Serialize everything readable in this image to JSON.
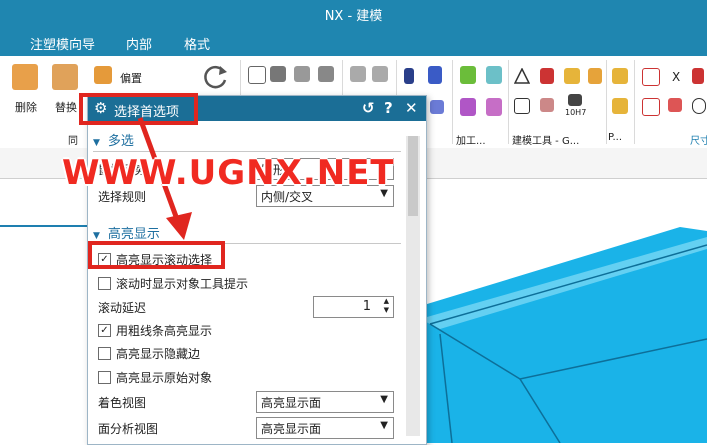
{
  "window": {
    "title": "NX - 建模"
  },
  "menu": {
    "items": [
      "注塑模向导",
      "内部",
      "格式"
    ]
  },
  "ribbon": {
    "delete_label": "删除",
    "replace_label": "替换",
    "offset_label": "偏置",
    "group_label_left": "同",
    "group_label_machining": "加工...",
    "group_label_modeling_tools": "建模工具 - G...",
    "group_label_p": "P...",
    "group_label_dim": "尺寸",
    "tool_text_x": "X",
    "tool_text_10h7": "10H7"
  },
  "dialog": {
    "title": "选择首选项",
    "reset_icon": "↺",
    "help_icon": "?",
    "close_icon": "✕",
    "section_multi": "多选",
    "gesture_label": "鼠标手势",
    "gesture_value": "矩形",
    "rule_label": "选择规则",
    "rule_value": "内侧/交叉",
    "section_highlight": "高亮显示",
    "cb_highlight_scroll": {
      "label": "高亮显示滚动选择",
      "checked": true
    },
    "cb_scroll_tooltip": {
      "label": "滚动时显示对象工具提示",
      "checked": false
    },
    "scroll_delay_label": "滚动延迟",
    "scroll_delay_value": "1",
    "cb_thick_lines": {
      "label": "用粗线条高亮显示",
      "checked": true
    },
    "cb_hidden_edges": {
      "label": "高亮显示隐藏边",
      "checked": false
    },
    "cb_original": {
      "label": "高亮显示原始对象",
      "checked": false
    },
    "shaded_view_label": "着色视图",
    "shaded_view_value": "高亮显示面",
    "face_analysis_label": "面分析视图",
    "face_analysis_value": "高亮显示面"
  },
  "watermark": "WWW.UGNX.NET",
  "colors": {
    "accent": "#1f86b0",
    "annotation": "#e0261f",
    "model": "#1ab3e8"
  }
}
